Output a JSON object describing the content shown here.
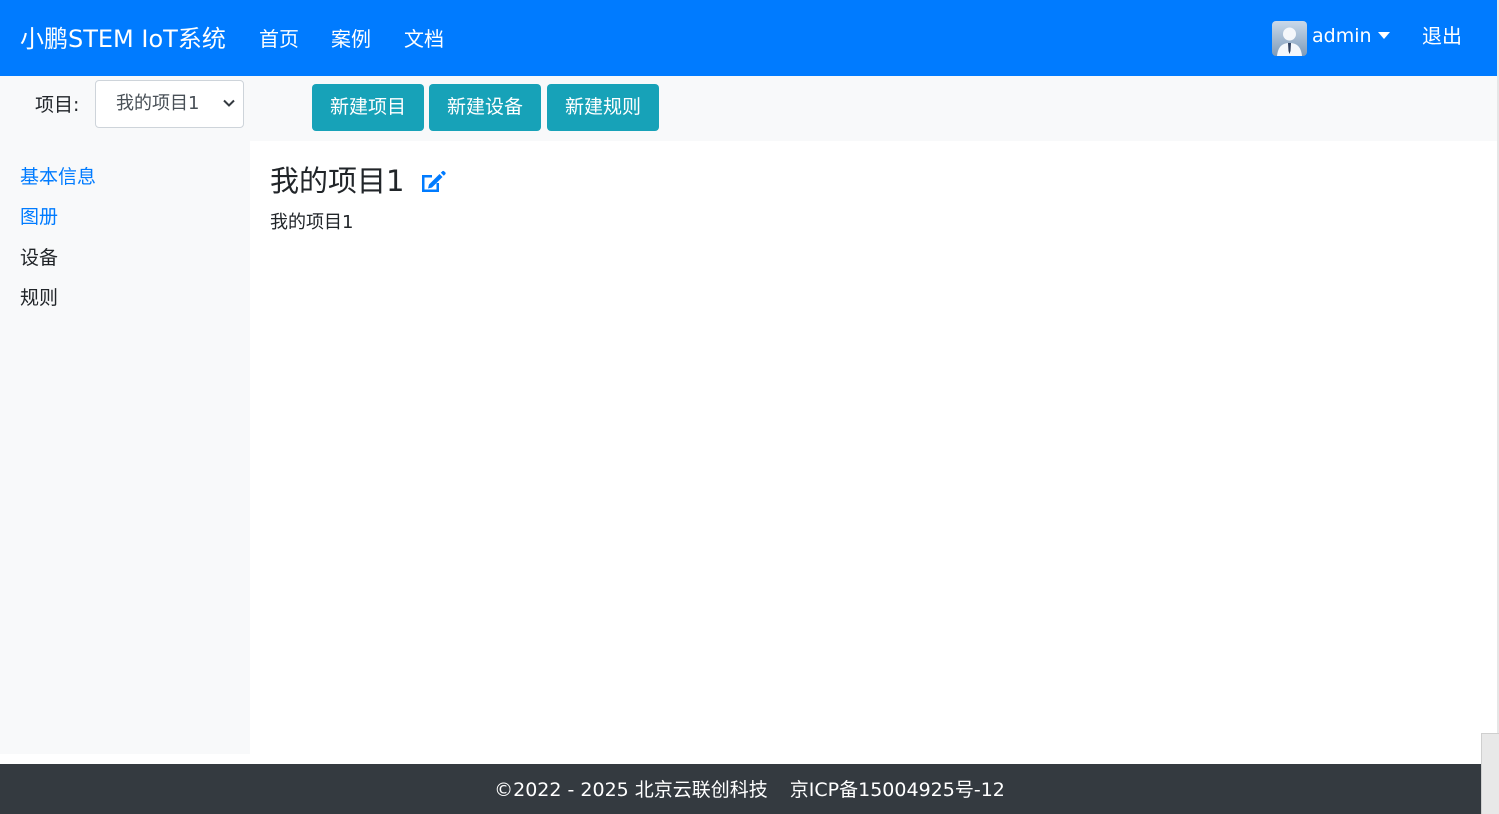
{
  "navbar": {
    "brand": "小鹏STEM IoT系统",
    "links": [
      "首页",
      "案例",
      "文档"
    ],
    "user": "admin",
    "logout": "退出",
    "bg_color": "#007bff"
  },
  "toolbar": {
    "project_label": "项目:",
    "project_select": "我的项目1",
    "buttons": [
      "新建项目",
      "新建设备",
      "新建规则"
    ],
    "button_color": "#17a2b8"
  },
  "sidebar": {
    "items": [
      {
        "label": "基本信息",
        "style": "link"
      },
      {
        "label": "图册",
        "style": "link"
      },
      {
        "label": "设备",
        "style": "plain"
      },
      {
        "label": "规则",
        "style": "plain"
      }
    ]
  },
  "main": {
    "title": "我的项目1",
    "description": "我的项目1",
    "edit_icon": "edit-icon"
  },
  "footer": {
    "copyright": "©2022 - 2025 北京云联创科技",
    "icp": "京ICP备15004925号-12",
    "bg_color": "#343a40"
  }
}
